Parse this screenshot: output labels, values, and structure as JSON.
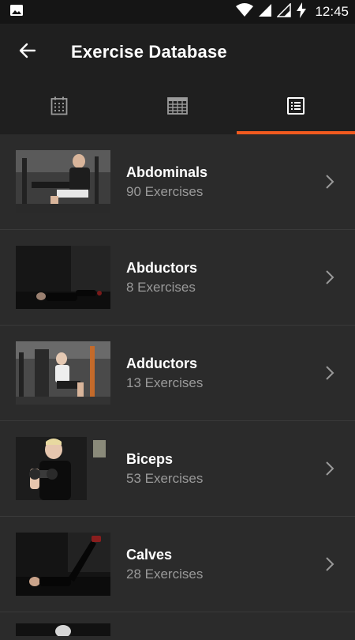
{
  "status_bar": {
    "time": "12:45"
  },
  "header": {
    "title": "Exercise Database"
  },
  "tabs": [
    {
      "name": "calendar",
      "icon": "calendar-icon"
    },
    {
      "name": "table",
      "icon": "table-grid-icon"
    },
    {
      "name": "list",
      "icon": "list-icon",
      "active": true
    }
  ],
  "colors": {
    "accent": "#f15a1f",
    "background": "#2b2b2b",
    "bar": "#1f1f1f"
  },
  "items": [
    {
      "muscle": "Abdominals",
      "count": "90 Exercises"
    },
    {
      "muscle": "Abductors",
      "count": "8 Exercises"
    },
    {
      "muscle": "Adductors",
      "count": "13 Exercises"
    },
    {
      "muscle": "Biceps",
      "count": "53 Exercises"
    },
    {
      "muscle": "Calves",
      "count": "28 Exercises"
    }
  ]
}
